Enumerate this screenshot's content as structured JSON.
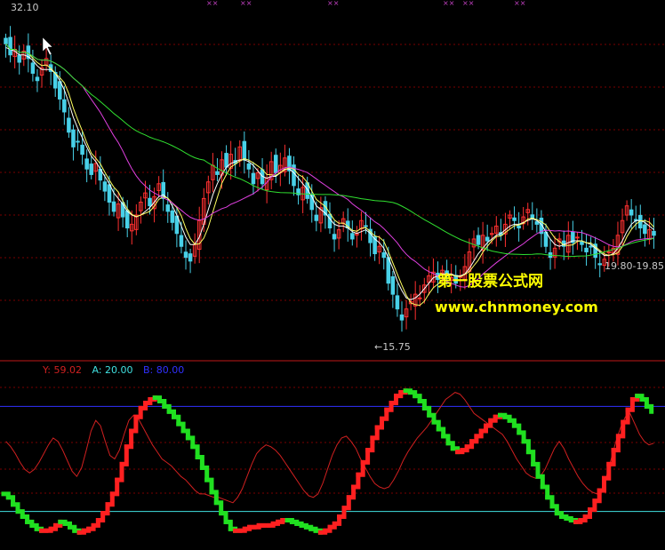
{
  "chart_data": [
    {
      "type": "candlestick",
      "title": "",
      "ylim": [
        15.0,
        33.0
      ],
      "labels": {
        "high": "32.10",
        "low": "←15.75",
        "last_range": "19.80-19.85"
      },
      "colors": {
        "up": "#ff3030",
        "down": "#48d1e8",
        "ma_fast": "#ffffff",
        "ma_mid": "#ffff60",
        "ma_slow": "#e040e0",
        "ma_long": "#30e030"
      },
      "close": [
        31.2,
        30.6,
        30.9,
        30.2,
        30.8,
        30.4,
        29.6,
        29.2,
        29.9,
        30.4,
        29.7,
        28.8,
        28.2,
        27.5,
        26.4,
        25.6,
        25.9,
        25.2,
        24.4,
        24.1,
        24.7,
        23.8,
        23.2,
        22.6,
        22.1,
        22.5,
        21.8,
        21.2,
        21.4,
        21.9,
        22.6,
        23.1,
        22.4,
        22.9,
        23.6,
        22.8,
        22.1,
        21.5,
        20.9,
        20.2,
        19.6,
        19.4,
        20.3,
        21.6,
        22.8,
        23.7,
        24.6,
        24.1,
        24.9,
        24.5,
        25.2,
        24.7,
        25.6,
        24.9,
        24.4,
        23.6,
        24.2,
        23.6,
        23.9,
        24.8,
        24.2,
        24.6,
        25.0,
        24.3,
        23.5,
        23.0,
        23.4,
        22.8,
        22.2,
        21.6,
        22.3,
        21.9,
        21.2,
        20.6,
        21.1,
        21.7,
        21.2,
        20.6,
        20.9,
        21.6,
        21.3,
        20.4,
        19.8,
        20.2,
        19.6,
        18.2,
        17.6,
        16.8,
        16.2,
        16.8,
        17.2,
        17.6,
        17.4,
        18.1,
        18.6,
        18.8,
        18.4,
        18.9,
        18.7,
        18.5,
        18.2,
        18.6,
        19.1,
        19.9,
        20.6,
        20.3,
        20.8,
        20.5,
        20.9,
        21.3,
        20.8,
        21.4,
        21.9,
        21.6,
        21.2,
        21.8,
        22.2,
        21.7,
        21.4,
        20.9,
        20.2,
        19.6,
        20.1,
        20.6,
        20.2,
        20.8,
        20.4,
        20.7,
        20.3,
        19.9,
        20.2,
        19.6,
        19.2,
        19.5,
        19.9,
        20.1,
        20.8,
        21.6,
        22.4,
        21.9,
        21.6,
        21.2,
        20.9,
        21.1,
        20.8
      ],
      "ma_fast": [
        31.0,
        30.9,
        30.8,
        30.6,
        30.6,
        30.5,
        30.3,
        30.0,
        29.8,
        29.8,
        29.8,
        29.6,
        29.2,
        28.7,
        28.0,
        27.2,
        26.6,
        26.1,
        25.6,
        25.1,
        24.8,
        24.4,
        24.0,
        23.6,
        23.1,
        22.8,
        22.5,
        22.1,
        21.9,
        21.8,
        21.9,
        22.1,
        22.3,
        22.6,
        22.9,
        23.0,
        22.8,
        22.4,
        21.9,
        21.3,
        20.7,
        20.3,
        20.3,
        20.7,
        21.4,
        22.2,
        23.0,
        23.6,
        24.1,
        24.5,
        24.7,
        24.8,
        24.9,
        24.9,
        24.8,
        24.6,
        24.3,
        24.0,
        23.9,
        24.0,
        24.0,
        24.2,
        24.4,
        24.4,
        24.2,
        23.9,
        23.6,
        23.3,
        22.9,
        22.4,
        22.2,
        22.0,
        21.7,
        21.4,
        21.3,
        21.3,
        21.2,
        21.0,
        20.9,
        21.0,
        21.1,
        20.9,
        20.6,
        20.4,
        20.1,
        19.6,
        19.0,
        18.3,
        17.8,
        17.4,
        17.3,
        17.4,
        17.6,
        17.9,
        18.2,
        18.5,
        18.6,
        18.7,
        18.7,
        18.7,
        18.6,
        18.6,
        18.7,
        19.0,
        19.4,
        19.8,
        20.1,
        20.4,
        20.6,
        20.8,
        20.9,
        21.1,
        21.3,
        21.4,
        21.4,
        21.5,
        21.6,
        21.7,
        21.6,
        21.4,
        21.0,
        20.6,
        20.3,
        20.2,
        20.3,
        20.4,
        20.5,
        20.5,
        20.5,
        20.4,
        20.3,
        20.1,
        19.9,
        19.7,
        19.7,
        19.8,
        20.1,
        20.5,
        21.0,
        21.4,
        21.6,
        21.6,
        21.5,
        21.3,
        21.1
      ]
    },
    {
      "type": "line",
      "title": "",
      "ylim": [
        0,
        100
      ],
      "legend": {
        "y": "Y: 59.02",
        "a": "A: 20.00",
        "b": "B: 80.00"
      },
      "reference_lines": [
        {
          "name": "A",
          "value": 20,
          "color": "#40e0e0"
        },
        {
          "name": "B",
          "value": 80,
          "color": "#3030ff"
        }
      ],
      "series": [
        {
          "name": "Y",
          "color": "#d02020",
          "values": [
            60,
            57,
            53,
            48,
            44,
            42,
            44,
            48,
            53,
            58,
            62,
            60,
            55,
            49,
            43,
            40,
            45,
            55,
            66,
            72,
            69,
            60,
            52,
            50,
            55,
            64,
            72,
            75,
            73,
            68,
            63,
            58,
            54,
            50,
            48,
            46,
            43,
            40,
            38,
            35,
            32,
            30,
            30,
            29,
            28,
            28,
            27,
            26,
            25,
            28,
            33,
            40,
            47,
            53,
            56,
            58,
            57,
            55,
            52,
            48,
            44,
            40,
            36,
            32,
            29,
            28,
            30,
            36,
            44,
            52,
            58,
            62,
            63,
            60,
            56,
            50,
            45,
            40,
            36,
            34,
            33,
            34,
            38,
            43,
            49,
            54,
            58,
            62,
            65,
            68,
            72,
            76,
            80,
            84,
            86,
            88,
            87,
            84,
            80,
            76,
            74,
            72,
            70,
            68,
            66,
            64,
            60,
            55,
            50,
            46,
            42,
            40,
            39,
            40,
            44,
            50,
            56,
            60,
            56,
            50,
            45,
            40,
            36,
            33,
            31,
            30,
            32,
            40,
            50,
            60,
            68,
            74,
            76,
            70,
            64,
            60,
            58,
            59
          ]
        },
        {
          "name": "K",
          "values": [
            30,
            28,
            24,
            20,
            17,
            14,
            12,
            10,
            9,
            9,
            10,
            12,
            14,
            13,
            11,
            9,
            8,
            9,
            10,
            12,
            15,
            19,
            24,
            30,
            38,
            47,
            57,
            66,
            74,
            79,
            82,
            84,
            85,
            83,
            80,
            77,
            74,
            70,
            66,
            62,
            57,
            51,
            45,
            38,
            31,
            25,
            19,
            14,
            10,
            9,
            9,
            10,
            11,
            11,
            12,
            12,
            12,
            13,
            14,
            15,
            15,
            14,
            13,
            12,
            11,
            10,
            9,
            8,
            9,
            11,
            13,
            17,
            22,
            28,
            34,
            41,
            48,
            55,
            62,
            68,
            73,
            78,
            82,
            86,
            88,
            89,
            88,
            86,
            83,
            79,
            75,
            71,
            67,
            63,
            59,
            56,
            54,
            55,
            57,
            60,
            63,
            66,
            69,
            72,
            74,
            75,
            74,
            72,
            69,
            65,
            60,
            54,
            47,
            40,
            34,
            28,
            23,
            19,
            17,
            16,
            15,
            14,
            15,
            17,
            21,
            26,
            32,
            39,
            47,
            55,
            63,
            71,
            78,
            84,
            86,
            84,
            80,
            77
          ]
        }
      ]
    }
  ],
  "watermark": {
    "title": "第一股票公式网",
    "url": "www.chnmoney.com"
  }
}
